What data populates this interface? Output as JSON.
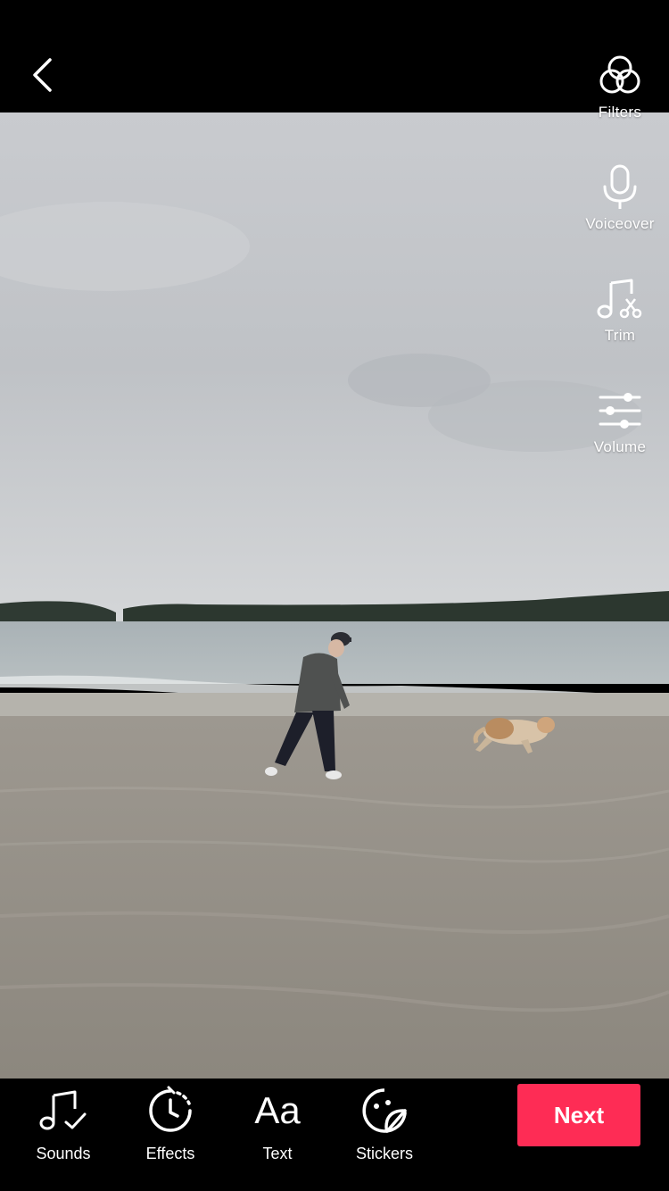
{
  "header": {
    "back_icon": "chevron-left-icon"
  },
  "side_tools": [
    {
      "label": "Filters",
      "icon": "filters-icon"
    },
    {
      "label": "Voiceover",
      "icon": "microphone-icon"
    },
    {
      "label": "Trim",
      "icon": "music-trim-icon"
    },
    {
      "label": "Volume",
      "icon": "sliders-icon"
    }
  ],
  "bottom_tools": [
    {
      "label": "Sounds",
      "icon": "music-note-check-icon"
    },
    {
      "label": "Effects",
      "icon": "timer-effects-icon"
    },
    {
      "label": "Text",
      "icon": "text-aa-icon",
      "glyph": "Aa"
    },
    {
      "label": "Stickers",
      "icon": "sticker-icon"
    }
  ],
  "next_button": {
    "label": "Next"
  },
  "colors": {
    "accent": "#fe2c55",
    "bar_background": "#000000",
    "icon": "#ffffff"
  }
}
